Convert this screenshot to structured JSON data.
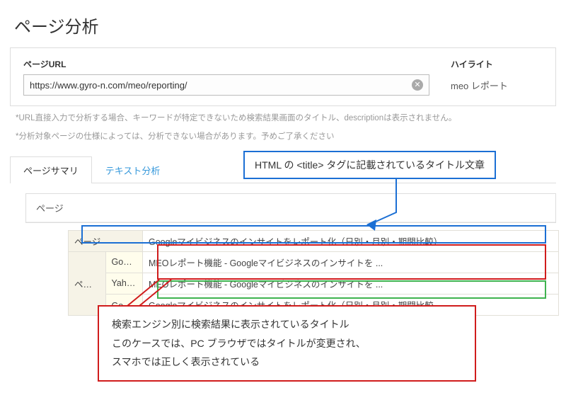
{
  "page_title": "ページ分析",
  "panel": {
    "url_label": "ページURL",
    "url_value": "https://www.gyro-n.com/meo/reporting/",
    "highlight_label": "ハイライト",
    "highlight_value": "meo レポート"
  },
  "hints": {
    "line1": "*URL直接入力で分析する場合、キーワードが特定できないため検索結果画面のタイトル、descriptionは表示されません。",
    "line2": "*分析対象ページの仕様によっては、分析できない場合があります。予めご了承ください"
  },
  "tabs": {
    "t0": "ページサマリ",
    "t1": "テキスト分析"
  },
  "sub_header": "ページ",
  "rows": {
    "page": {
      "label": "ページ",
      "val": "Googleマイビジネスのインサイトをレポート化（日別・月別・期間比較）"
    },
    "pt_label": "ページタイトル",
    "google": {
      "engine": "Google",
      "val": "MEOレポート機能 - Googleマイビジネスのインサイトを ..."
    },
    "yahoo": {
      "engine": "Yahoo! JAPAN",
      "val": "MEOレポート機能 - Googleマイビジネスのインサイトを ..."
    },
    "sp": {
      "engine": "Google (スマホ検索)",
      "val": "Googleマイビジネスのインサイトをレポート化（日別・月別・期間比較 ..."
    }
  },
  "anno": {
    "top": "HTML の <title> タグに記載されているタイトル文章",
    "bottom1": "検索エンジン別に検索結果に表示されているタイトル",
    "bottom2": "このケースでは、PC ブラウザではタイトルが変更され、",
    "bottom3": "スマホでは正しく表示されている"
  }
}
